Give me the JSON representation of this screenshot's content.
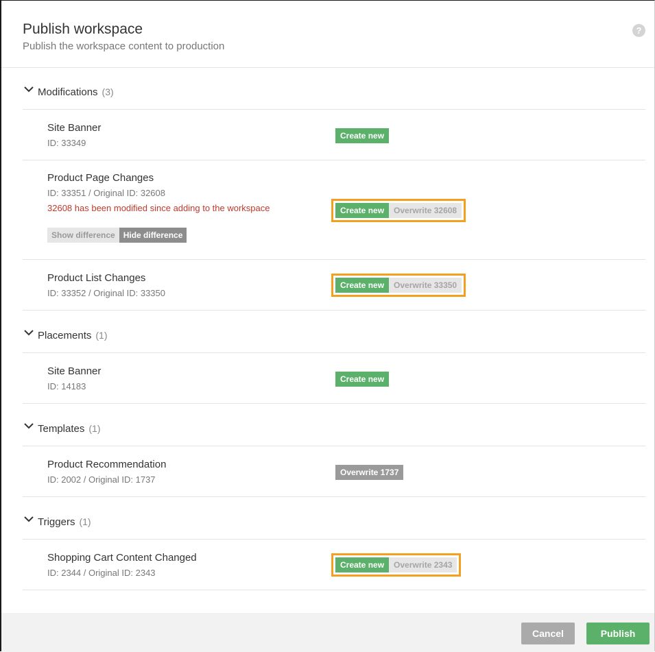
{
  "header": {
    "title": "Publish workspace",
    "subtitle": "Publish the workspace content to production",
    "help_icon": "?"
  },
  "sections": [
    {
      "title": "Modifications",
      "count": "(3)",
      "items": [
        {
          "name": "Site Banner",
          "id": "ID: 33349",
          "create": "Create new"
        },
        {
          "name": "Product Page Changes",
          "id": "ID: 33351 / Original ID: 32608",
          "warning": "32608 has been modified since adding to the workspace",
          "create": "Create new",
          "overwrite": "Overwrite 32608",
          "show_diff": "Show difference",
          "hide_diff": "Hide difference"
        },
        {
          "name": "Product List Changes",
          "id": "ID: 33352 / Original ID: 33350",
          "create": "Create new",
          "overwrite": "Overwrite 33350"
        }
      ]
    },
    {
      "title": "Placements",
      "count": "(1)",
      "items": [
        {
          "name": "Site Banner",
          "id": "ID: 14183",
          "create": "Create new"
        }
      ]
    },
    {
      "title": "Templates",
      "count": "(1)",
      "items": [
        {
          "name": "Product Recommendation",
          "id": "ID: 2002 / Original ID: 1737",
          "overwrite": "Overwrite 1737"
        }
      ]
    },
    {
      "title": "Triggers",
      "count": "(1)",
      "items": [
        {
          "name": "Shopping Cart Content Changed",
          "id": "ID: 2344 / Original ID: 2343",
          "create": "Create new",
          "overwrite": "Overwrite 2343"
        }
      ]
    }
  ],
  "footer": {
    "cancel": "Cancel",
    "publish": "Publish"
  },
  "colors": {
    "green": "#5cb16a",
    "highlight": "#f2a01e",
    "warning": "#c0392b"
  }
}
